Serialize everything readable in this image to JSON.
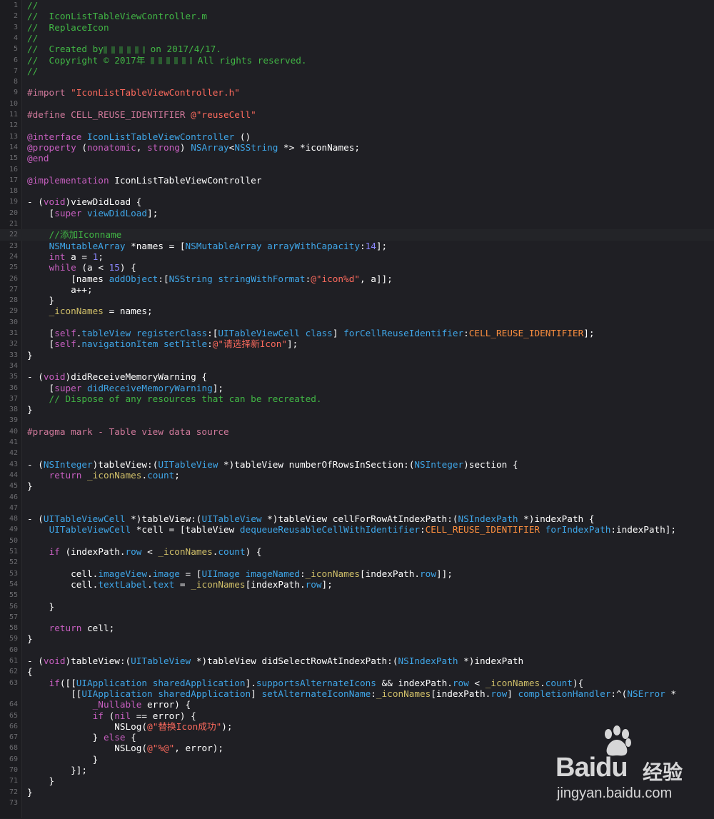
{
  "editor": {
    "current_line": 22,
    "lines": [
      [
        [
          "c",
          "//"
        ]
      ],
      [
        [
          "c",
          "//  IconListTableViewController.m"
        ]
      ],
      [
        [
          "c",
          "//  ReplaceIcon"
        ]
      ],
      [
        [
          "c",
          "//"
        ]
      ],
      [
        [
          "c",
          "//  Created by"
        ],
        [
          "blur",
          ""
        ],
        [
          "c",
          " on 2017/4/17."
        ]
      ],
      [
        [
          "c",
          "//  Copyright © 2017年 "
        ],
        [
          "blur",
          ""
        ],
        [
          "c",
          " All rights reserved."
        ]
      ],
      [
        [
          "c",
          "//"
        ]
      ],
      [],
      [
        [
          "pre",
          "#import "
        ],
        [
          "ps",
          "\"IconListTableViewController.h\""
        ]
      ],
      [],
      [
        [
          "pre",
          "#define CELL_REUSE_IDENTIFIER "
        ],
        [
          "ps",
          "@\"reuseCell\""
        ]
      ],
      [],
      [
        [
          "k",
          "@interface "
        ],
        [
          "t",
          "IconListTableViewController"
        ],
        [
          "p",
          " ()"
        ]
      ],
      [
        [
          "k",
          "@property "
        ],
        [
          "p",
          "("
        ],
        [
          "k",
          "nonatomic"
        ],
        [
          "p",
          ", "
        ],
        [
          "k",
          "strong"
        ],
        [
          "p",
          ") "
        ],
        [
          "t",
          "NSArray"
        ],
        [
          "p",
          "<"
        ],
        [
          "t",
          "NSString"
        ],
        [
          "p",
          " *> *iconNames;"
        ]
      ],
      [
        [
          "k",
          "@end"
        ]
      ],
      [],
      [
        [
          "k",
          "@implementation "
        ],
        [
          "p",
          "IconListTableViewController"
        ]
      ],
      [],
      [
        [
          "p",
          "- ("
        ],
        [
          "k",
          "void"
        ],
        [
          "p",
          ")viewDidLoad {"
        ]
      ],
      [
        [
          "p",
          "    ["
        ],
        [
          "k",
          "super"
        ],
        [
          "p",
          " "
        ],
        [
          "m",
          "viewDidLoad"
        ],
        [
          "p",
          "];"
        ]
      ],
      [],
      [
        [
          "c",
          "    //添加Iconname"
        ]
      ],
      [
        [
          "p",
          "    "
        ],
        [
          "t",
          "NSMutableArray"
        ],
        [
          "p",
          " *names = ["
        ],
        [
          "t",
          "NSMutableArray"
        ],
        [
          "p",
          " "
        ],
        [
          "m",
          "arrayWithCapacity"
        ],
        [
          "p",
          ":"
        ],
        [
          "n",
          "14"
        ],
        [
          "p",
          "];"
        ]
      ],
      [
        [
          "p",
          "    "
        ],
        [
          "k",
          "int"
        ],
        [
          "p",
          " a = "
        ],
        [
          "n",
          "1"
        ],
        [
          "p",
          ";"
        ]
      ],
      [
        [
          "p",
          "    "
        ],
        [
          "k",
          "while"
        ],
        [
          "p",
          " (a < "
        ],
        [
          "n",
          "15"
        ],
        [
          "p",
          ") {"
        ]
      ],
      [
        [
          "p",
          "        [names "
        ],
        [
          "m",
          "addObject"
        ],
        [
          "p",
          ":["
        ],
        [
          "t",
          "NSString"
        ],
        [
          "p",
          " "
        ],
        [
          "m",
          "stringWithFormat"
        ],
        [
          "p",
          ":"
        ],
        [
          "s",
          "@\"icon%d\""
        ],
        [
          "p",
          ", a]];"
        ]
      ],
      [
        [
          "p",
          "        a++;"
        ]
      ],
      [
        [
          "p",
          "    }"
        ]
      ],
      [
        [
          "p",
          "    "
        ],
        [
          "i",
          "_iconNames"
        ],
        [
          "p",
          " = names;"
        ]
      ],
      [],
      [
        [
          "p",
          "    ["
        ],
        [
          "k",
          "self"
        ],
        [
          "p",
          "."
        ],
        [
          "pr",
          "tableView"
        ],
        [
          "p",
          " "
        ],
        [
          "m",
          "registerClass"
        ],
        [
          "p",
          ":["
        ],
        [
          "t",
          "UITableViewCell"
        ],
        [
          "p",
          " "
        ],
        [
          "m",
          "class"
        ],
        [
          "p",
          "] "
        ],
        [
          "m",
          "forCellReuseIdentifier"
        ],
        [
          "p",
          ":"
        ],
        [
          "mc",
          "CELL_REUSE_IDENTIFIER"
        ],
        [
          "p",
          "];"
        ]
      ],
      [
        [
          "p",
          "    ["
        ],
        [
          "k",
          "self"
        ],
        [
          "p",
          "."
        ],
        [
          "pr",
          "navigationItem"
        ],
        [
          "p",
          " "
        ],
        [
          "m",
          "setTitle"
        ],
        [
          "p",
          ":"
        ],
        [
          "s",
          "@\"请选择新Icon\""
        ],
        [
          "p",
          "];"
        ]
      ],
      [
        [
          "p",
          "}"
        ]
      ],
      [],
      [
        [
          "p",
          "- ("
        ],
        [
          "k",
          "void"
        ],
        [
          "p",
          ")didReceiveMemoryWarning {"
        ]
      ],
      [
        [
          "p",
          "    ["
        ],
        [
          "k",
          "super"
        ],
        [
          "p",
          " "
        ],
        [
          "m",
          "didReceiveMemoryWarning"
        ],
        [
          "p",
          "];"
        ]
      ],
      [
        [
          "c",
          "    // Dispose of any resources that can be recreated."
        ]
      ],
      [
        [
          "p",
          "}"
        ]
      ],
      [],
      [
        [
          "pre",
          "#pragma mark - Table view data source"
        ]
      ],
      [],
      [],
      [
        [
          "p",
          "- ("
        ],
        [
          "t",
          "NSInteger"
        ],
        [
          "p",
          ")tableView:("
        ],
        [
          "t",
          "UITableView"
        ],
        [
          "p",
          " *)tableView numberOfRowsInSection:("
        ],
        [
          "t",
          "NSInteger"
        ],
        [
          "p",
          ")section {"
        ]
      ],
      [
        [
          "p",
          "    "
        ],
        [
          "k",
          "return"
        ],
        [
          "p",
          " "
        ],
        [
          "i",
          "_iconNames"
        ],
        [
          "p",
          "."
        ],
        [
          "pr",
          "count"
        ],
        [
          "p",
          ";"
        ]
      ],
      [
        [
          "p",
          "}"
        ]
      ],
      [],
      [],
      [
        [
          "p",
          "- ("
        ],
        [
          "t",
          "UITableViewCell"
        ],
        [
          "p",
          " *)tableView:("
        ],
        [
          "t",
          "UITableView"
        ],
        [
          "p",
          " *)tableView cellForRowAtIndexPath:("
        ],
        [
          "t",
          "NSIndexPath"
        ],
        [
          "p",
          " *)indexPath {"
        ]
      ],
      [
        [
          "p",
          "    "
        ],
        [
          "t",
          "UITableViewCell"
        ],
        [
          "p",
          " *cell = [tableView "
        ],
        [
          "m",
          "dequeueReusableCellWithIdentifier"
        ],
        [
          "p",
          ":"
        ],
        [
          "mc",
          "CELL_REUSE_IDENTIFIER"
        ],
        [
          "p",
          " "
        ],
        [
          "m",
          "forIndexPath"
        ],
        [
          "p",
          ":indexPath];"
        ]
      ],
      [],
      [
        [
          "p",
          "    "
        ],
        [
          "k",
          "if"
        ],
        [
          "p",
          " (indexPath."
        ],
        [
          "pr",
          "row"
        ],
        [
          "p",
          " < "
        ],
        [
          "i",
          "_iconNames"
        ],
        [
          "p",
          "."
        ],
        [
          "pr",
          "count"
        ],
        [
          "p",
          ") {"
        ]
      ],
      [],
      [
        [
          "p",
          "        cell."
        ],
        [
          "pr",
          "imageView"
        ],
        [
          "p",
          "."
        ],
        [
          "pr",
          "image"
        ],
        [
          "p",
          " = ["
        ],
        [
          "t",
          "UIImage"
        ],
        [
          "p",
          " "
        ],
        [
          "m",
          "imageNamed"
        ],
        [
          "p",
          ":"
        ],
        [
          "i",
          "_iconNames"
        ],
        [
          "p",
          "[indexPath."
        ],
        [
          "pr",
          "row"
        ],
        [
          "p",
          "]];"
        ]
      ],
      [
        [
          "p",
          "        cell."
        ],
        [
          "pr",
          "textLabel"
        ],
        [
          "p",
          "."
        ],
        [
          "pr",
          "text"
        ],
        [
          "p",
          " = "
        ],
        [
          "i",
          "_iconNames"
        ],
        [
          "p",
          "[indexPath."
        ],
        [
          "pr",
          "row"
        ],
        [
          "p",
          "];"
        ]
      ],
      [],
      [
        [
          "p",
          "    }"
        ]
      ],
      [],
      [
        [
          "p",
          "    "
        ],
        [
          "k",
          "return"
        ],
        [
          "p",
          " cell;"
        ]
      ],
      [
        [
          "p",
          "}"
        ]
      ],
      [],
      [
        [
          "p",
          "- ("
        ],
        [
          "k",
          "void"
        ],
        [
          "p",
          ")tableView:("
        ],
        [
          "t",
          "UITableView"
        ],
        [
          "p",
          " *)tableView didSelectRowAtIndexPath:("
        ],
        [
          "t",
          "NSIndexPath"
        ],
        [
          "p",
          " *)indexPath"
        ]
      ],
      [
        [
          "p",
          "{"
        ]
      ],
      [
        [
          "p",
          "    "
        ],
        [
          "k",
          "if"
        ],
        [
          "p",
          "([["
        ],
        [
          "t",
          "UIApplication"
        ],
        [
          "p",
          " "
        ],
        [
          "m",
          "sharedApplication"
        ],
        [
          "p",
          "]."
        ],
        [
          "pr",
          "supportsAlternateIcons"
        ],
        [
          "p",
          " && indexPath."
        ],
        [
          "pr",
          "row"
        ],
        [
          "p",
          " < "
        ],
        [
          "i",
          "_iconNames"
        ],
        [
          "p",
          "."
        ],
        [
          "pr",
          "count"
        ],
        [
          "p",
          "){"
        ]
      ],
      [
        [
          "p",
          "        [["
        ],
        [
          "t",
          "UIApplication"
        ],
        [
          "p",
          " "
        ],
        [
          "m",
          "sharedApplication"
        ],
        [
          "p",
          "] "
        ],
        [
          "m",
          "setAlternateIconName"
        ],
        [
          "p",
          ":"
        ],
        [
          "i",
          "_iconNames"
        ],
        [
          "p",
          "[indexPath."
        ],
        [
          "pr",
          "row"
        ],
        [
          "p",
          "] "
        ],
        [
          "m",
          "completionHandler"
        ],
        [
          "p",
          ":^("
        ],
        [
          "t",
          "NSError"
        ],
        [
          "p",
          " *"
        ]
      ],
      [
        [
          "p",
          "            "
        ],
        [
          "k",
          "_Nullable"
        ],
        [
          "p",
          " error) {"
        ]
      ],
      [
        [
          "p",
          "            "
        ],
        [
          "k",
          "if"
        ],
        [
          "p",
          " ("
        ],
        [
          "k",
          "nil"
        ],
        [
          "p",
          " == error) {"
        ]
      ],
      [
        [
          "p",
          "                NSLog("
        ],
        [
          "s",
          "@\"替换Icon成功\""
        ],
        [
          "p",
          ");"
        ]
      ],
      [
        [
          "p",
          "            } "
        ],
        [
          "k",
          "else"
        ],
        [
          "p",
          " {"
        ]
      ],
      [
        [
          "p",
          "                NSLog("
        ],
        [
          "s",
          "@\"%@\""
        ],
        [
          "p",
          ", error);"
        ]
      ],
      [
        [
          "p",
          "            }"
        ]
      ],
      [
        [
          "p",
          "        }];"
        ]
      ],
      [
        [
          "p",
          "    }"
        ]
      ],
      [
        [
          "p",
          "}"
        ]
      ],
      [],
      []
    ],
    "line_numbers": [
      "1",
      "2",
      "3",
      "4",
      "5",
      "6",
      "7",
      "8",
      "9",
      "10",
      "11",
      "12",
      "13",
      "14",
      "15",
      "16",
      "17",
      "18",
      "19",
      "20",
      "21",
      "22",
      "23",
      "24",
      "25",
      "26",
      "27",
      "28",
      "29",
      "30",
      "31",
      "32",
      "33",
      "34",
      "35",
      "36",
      "37",
      "38",
      "39",
      "40",
      "41",
      "42",
      "43",
      "44",
      "45",
      "46",
      "47",
      "48",
      "49",
      "50",
      "51",
      "52",
      "53",
      "54",
      "55",
      "56",
      "57",
      "58",
      "59",
      "60",
      "61",
      "62",
      "63",
      "",
      "64",
      "65",
      "66",
      "67",
      "68",
      "69",
      "70",
      "71",
      "72",
      "73"
    ]
  },
  "watermark": {
    "brand": "Bai",
    "brand_suffix": "du",
    "sub": "经验",
    "url": "jingyan.baidu.com"
  },
  "colors": {
    "background": "#1f1f24",
    "comment": "#41b645",
    "keyword": "#c75fc0",
    "string": "#fc6a5d",
    "type": "#3fa6e8",
    "number": "#8b87ff"
  }
}
